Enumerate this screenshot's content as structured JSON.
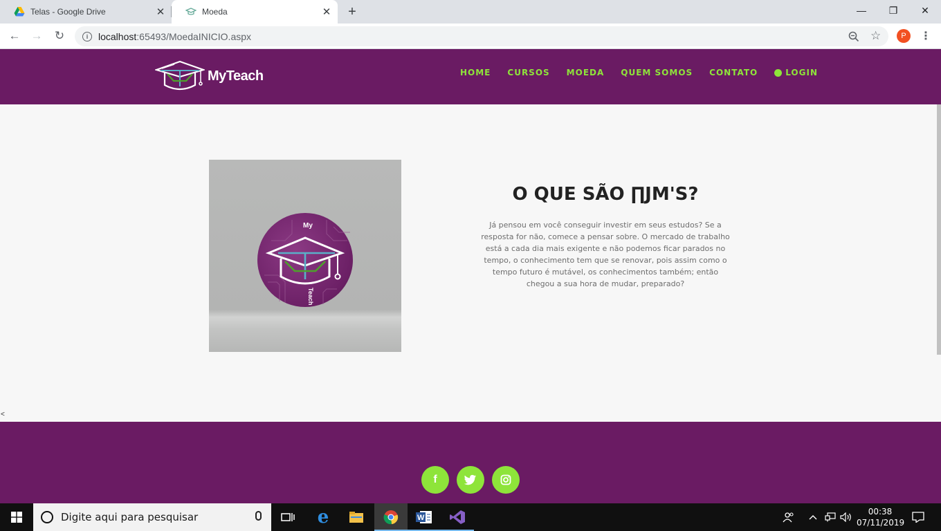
{
  "browser": {
    "tabs": [
      {
        "title": "Telas - Google Drive",
        "icon": "google-drive-icon"
      },
      {
        "title": "Moeda",
        "icon": "graduation-cap-icon"
      }
    ],
    "url_host": "localhost",
    "url_path": ":65493/MoedaINICIO.aspx",
    "profile_initial": "P"
  },
  "site": {
    "brand": "MyTeach",
    "nav": [
      {
        "label": "HOME"
      },
      {
        "label": "CURSOS"
      },
      {
        "label": "MOEDA"
      },
      {
        "label": "QUEM SOMOS"
      },
      {
        "label": "CONTATO"
      },
      {
        "label": "LOGIN",
        "icon": "user-circle-icon"
      }
    ],
    "accent_color": "#8ee43a",
    "brand_color": "#6a1b63",
    "coin": {
      "top_text": "My",
      "bottom_text": "Teach"
    },
    "content": {
      "title": "O QUE SÃO ∏JM'S?",
      "text": "Já pensou em você conseguir investir em seus estudos? Se a resposta for não, comece a pensar sobre. O mercado de trabalho está a cada dia mais exigente e não podemos ficar parados no tempo, o conhecimento tem que se renovar, pois assim como o tempo futuro é mutável, os conhecimentos também; então chegou a sua hora de mudar, preparado?"
    },
    "stray_text": "<",
    "social": [
      {
        "icon": "facebook-icon",
        "glyph": "f"
      },
      {
        "icon": "twitter-icon",
        "glyph": ""
      },
      {
        "icon": "instagram-icon",
        "glyph": ""
      }
    ]
  },
  "taskbar": {
    "search_placeholder": "Digite aqui para pesquisar",
    "time": "00:38",
    "date": "07/11/2019"
  }
}
